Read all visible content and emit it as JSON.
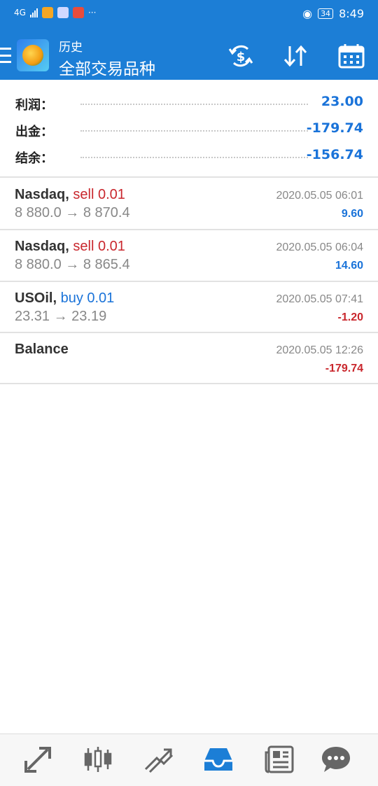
{
  "status_bar": {
    "network": "4G",
    "time": "8:49",
    "battery": "34"
  },
  "header": {
    "title_small": "历史",
    "title_big": "全部交易品种"
  },
  "summary": [
    {
      "label": "利润：",
      "value": "23.00"
    },
    {
      "label": "出金：",
      "value": "-179.74"
    },
    {
      "label": "结余：",
      "value": "-156.74"
    }
  ],
  "trades": [
    {
      "symbol": "Nasdaq,",
      "side": "sell 0.01",
      "prices": "8 880.0 → 8 870.4",
      "time": "2020.05.05 06:01",
      "profit": "9.60"
    },
    {
      "symbol": "Nasdaq,",
      "side": "sell 0.01",
      "prices": "8 880.0 → 8 865.4",
      "time": "2020.05.05 06:04",
      "profit": "14.60"
    },
    {
      "symbol": "USOil,",
      "side": "buy 0.01",
      "prices": "23.31 → 23.19",
      "time": "2020.05.05 07:41",
      "profit": "-1.20"
    },
    {
      "symbol": "Balance",
      "side": "",
      "prices": "",
      "time": "2020.05.05 12:26",
      "profit": "-179.74"
    }
  ],
  "colors": {
    "header_bg": "#1c7ed6",
    "value_blue": "#1a73d9",
    "sell_red": "#c9272d",
    "active_nav": "#1c7ed6"
  },
  "icons": {
    "toolbar": [
      "currency-exchange-icon",
      "sort-icon",
      "calendar-icon"
    ],
    "bottom_nav": [
      "quotes-icon",
      "chart-icon",
      "trade-icon",
      "history-icon",
      "news-icon",
      "chat-icon"
    ]
  }
}
